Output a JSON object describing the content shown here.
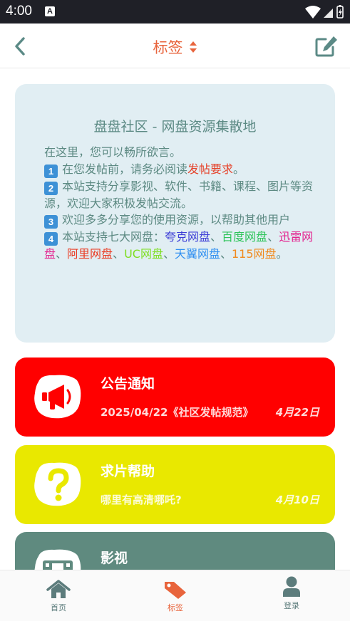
{
  "status_bar": {
    "time": "4:00",
    "notification_badge": "A"
  },
  "app_bar": {
    "title": "标签",
    "back_icon": "chevron-left-icon",
    "sort_icon": "sort-icon",
    "edit_icon": "edit-icon"
  },
  "intro": {
    "title": "盘盘社区 - 网盘资源集散地",
    "welcome": "在这里，您可以畅所欲言。",
    "items": [
      {
        "num": "1",
        "text_before": "在您发帖前，请务必阅读",
        "link": "发帖要求",
        "text_after": "。"
      },
      {
        "num": "2",
        "text": "本站支持分享影视、软件、书籍、课程、图片等资源，欢迎大家积极发帖交流。"
      },
      {
        "num": "3",
        "text": "欢迎多多分享您的使用资源，以帮助其他用户"
      },
      {
        "num": "4",
        "text_before": "本站支持七大网盘："
      }
    ],
    "drives": [
      "夸克网盘",
      "百度网盘",
      "迅雷网盘",
      "阿里网盘",
      "UC网盘",
      "天翼网盘",
      "115网盘"
    ],
    "separator": "、",
    "end": "。",
    "colors": {
      "text": "#5d8a83",
      "link": "#e5432b",
      "quark": "#3d3ed6",
      "baidu": "#2ec45a",
      "xunlei": "#e3248f",
      "ali": "#ea3b22",
      "uc": "#7ede22",
      "tianyi": "#2f8ff1",
      "pan115": "#f08a1e"
    }
  },
  "categories": [
    {
      "name": "公告通知",
      "latest": "2025/04/22《社区发帖规范》",
      "date": "4月22日",
      "color": "#ff0000",
      "icon": "megaphone-icon"
    },
    {
      "name": "求片帮助",
      "latest": "哪里有高清哪吒?",
      "date": "4月10日",
      "color": "#e9e800",
      "icon": "question-icon"
    },
    {
      "name": "影视",
      "color": "#5f8a7f",
      "icon": "film-icon"
    }
  ],
  "bottom_nav": [
    {
      "label": "首页",
      "icon": "home-icon",
      "active": false
    },
    {
      "label": "标签",
      "icon": "tag-icon",
      "active": true
    },
    {
      "label": "登录",
      "icon": "user-icon",
      "active": false
    }
  ],
  "accent_color": "#e8643c"
}
